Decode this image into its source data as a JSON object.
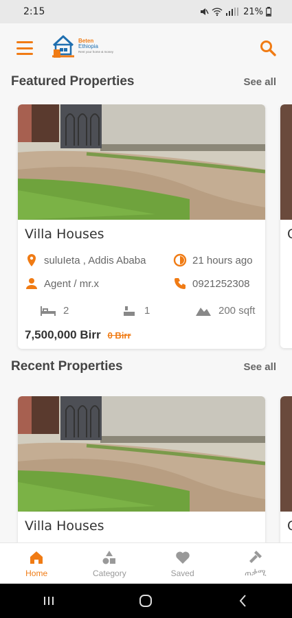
{
  "status_bar": {
    "time": "2:15",
    "battery": "21%"
  },
  "app_bar": {
    "logo_line1": "Beten",
    "logo_line2": "Ethiopia",
    "logo_tagline": "Rent your home & money"
  },
  "featured": {
    "title": "Featured Properties",
    "see_all": "See all",
    "card": {
      "title": "Villa Houses",
      "location": "suluIeta , Addis Ababa",
      "time_ago": "21 hours ago",
      "agent": "Agent / mr.x",
      "phone": "0921252308",
      "beds": "2",
      "baths": "1",
      "area": "200 sqft",
      "price": "7,500,000 Birr",
      "old_price": "0 Birr"
    },
    "peek_title": "C"
  },
  "recent": {
    "title": "Recent Properties",
    "see_all": "See all",
    "card": {
      "title": "Villa Houses"
    },
    "peek_title": "C"
  },
  "bottom_nav": [
    {
      "label": "Home",
      "icon": "home-icon",
      "active": true
    },
    {
      "label": "Category",
      "icon": "category-icon",
      "active": false
    },
    {
      "label": "Saved",
      "icon": "heart-icon",
      "active": false
    },
    {
      "label": "ጠቃሚ",
      "icon": "hammer-icon",
      "active": false
    }
  ],
  "colors": {
    "accent": "#f07b14",
    "brand_blue": "#1f6fb0"
  }
}
